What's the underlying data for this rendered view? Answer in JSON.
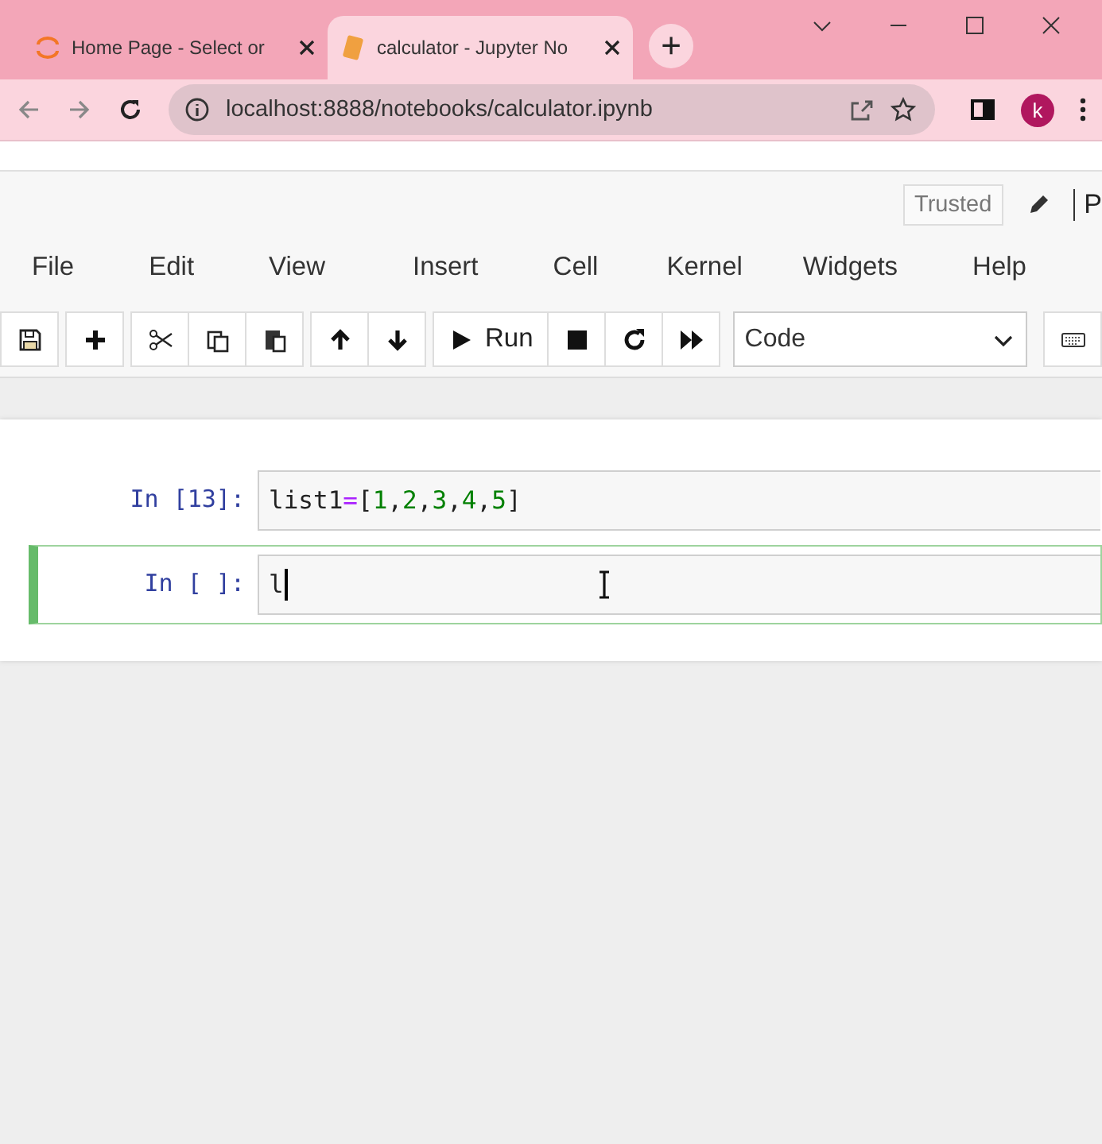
{
  "browser": {
    "tabs": [
      {
        "title": "Home Page - Select or",
        "selected": false
      },
      {
        "title": "calculator - Jupyter No",
        "selected": true
      }
    ],
    "new_tab": "+",
    "address": "localhost:8888/notebooks/calculator.ipynb",
    "profile": "k"
  },
  "header": {
    "trusted": "Trusted",
    "cut_text": "P"
  },
  "menu": [
    "File",
    "Edit",
    "View",
    "Insert",
    "Cell",
    "Kernel",
    "Widgets",
    "Help"
  ],
  "toolbar": {
    "run_label": "Run",
    "cell_type": "Code"
  },
  "cells": [
    {
      "prompt": "In [13]:",
      "selected": false,
      "tokens": [
        {
          "kind": "name",
          "text": "list1"
        },
        {
          "kind": "operator",
          "text": "="
        },
        {
          "kind": "punct",
          "text": "["
        },
        {
          "kind": "number",
          "text": "1"
        },
        {
          "kind": "punct",
          "text": ","
        },
        {
          "kind": "number",
          "text": "2"
        },
        {
          "kind": "punct",
          "text": ","
        },
        {
          "kind": "number",
          "text": "3"
        },
        {
          "kind": "punct",
          "text": ","
        },
        {
          "kind": "number",
          "text": "4"
        },
        {
          "kind": "punct",
          "text": ","
        },
        {
          "kind": "number",
          "text": "5"
        },
        {
          "kind": "punct",
          "text": "]"
        }
      ]
    },
    {
      "prompt": "In [ ]:",
      "selected": true,
      "tokens": [
        {
          "kind": "name",
          "text": "l"
        }
      ]
    }
  ]
}
